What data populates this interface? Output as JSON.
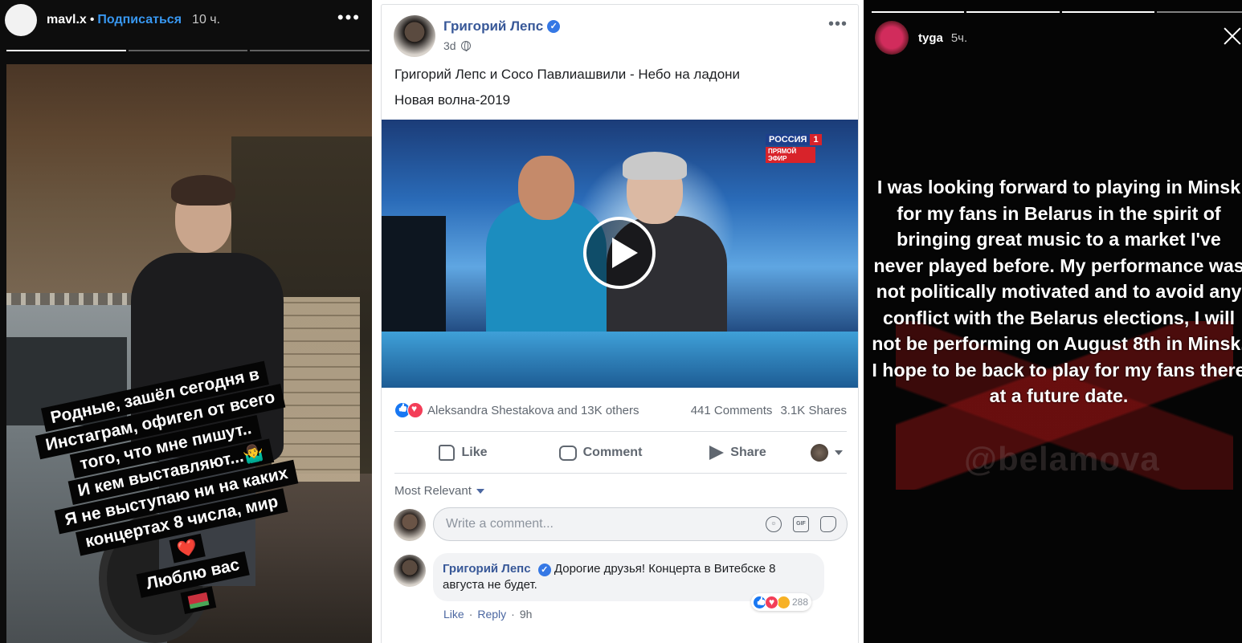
{
  "left_story": {
    "username": "mavl.x",
    "separator": "•",
    "follow_label": "Подписаться",
    "time": "10 ч.",
    "more_icon": "more-dots-icon",
    "caption_lines": [
      "Родные, зашёл сегодня в",
      "Инстаграм, офигел от всего",
      "того, что мне пишут..",
      "И кем выставляют...🤷‍♂️",
      "Я не выступаю ни на каких",
      "концертах 8 числа, мир",
      "❤️",
      "Люблю вас"
    ]
  },
  "fb_post": {
    "author": "Григорий Лепс",
    "time": "3d",
    "text_line1": "Григорий Лепс и Сосо Павлиашвили - Небо на ладони",
    "text_line2": "Новая волна-2019",
    "video_logo_channel": "РОССИЯ",
    "video_logo_number": "1",
    "video_logo_live": "ПРЯМОЙ ЭФИР",
    "reactions_who": "Aleksandra Shestakova and 13K others",
    "comments_count": "441 Comments",
    "shares_count": "3.1K Shares",
    "actions": {
      "like": "Like",
      "comment": "Comment",
      "share": "Share"
    },
    "sort_label": "Most Relevant",
    "comment_placeholder": "Write a comment...",
    "gif_label": "GIF",
    "comment": {
      "author": "Григорий Лепс",
      "text": "Дорогие друзья! Концерта в Витебске 8 августа не будет.",
      "reactions_count": "288",
      "like": "Like",
      "reply": "Reply",
      "sep": "·",
      "time": "9h"
    },
    "colors": {
      "link": "#385898",
      "verified": "#3578e5",
      "like": "#1877f2",
      "love": "#f33e58"
    }
  },
  "right_story": {
    "username": "tyga",
    "time": "5ч.",
    "close_icon": "close-icon",
    "statement": "I was looking forward to playing in Minsk for my fans in Belarus in the spirit of bringing great music to a market I've never played before. My performance was not politically motivated and to avoid any conflict with the Belarus elections, I will not be performing on August 8th in Minsk. I hope to be back to play for my fans there at a future date.",
    "watermark": "@belamova"
  }
}
